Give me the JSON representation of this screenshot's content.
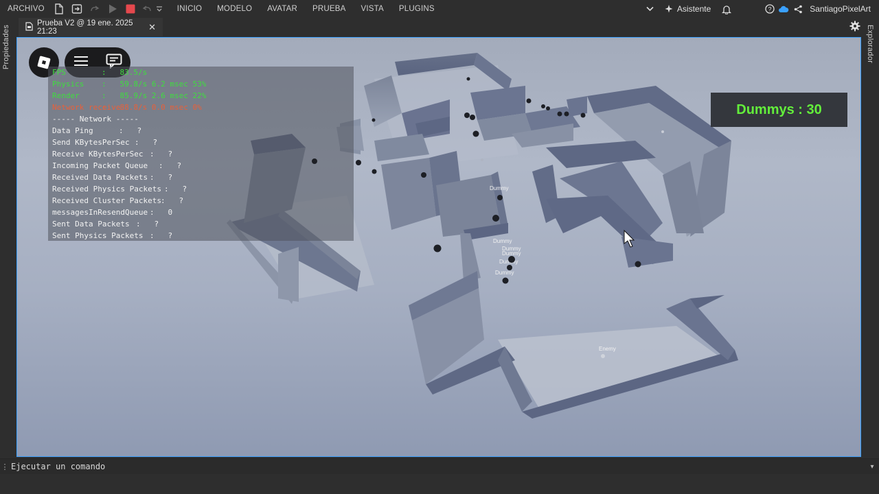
{
  "menu": {
    "file_label": "ARCHIVO",
    "items": [
      "INICIO",
      "MODELO",
      "AVATAR",
      "PRUEBA",
      "VISTA",
      "PLUGINS"
    ],
    "assistant_label": "Asistente",
    "username": "SantiagoPixelArt"
  },
  "tab": {
    "title": "Prueba V2 @ 19 ene. 2025 21:23",
    "close_glyph": "✕"
  },
  "rails": {
    "left_label": "Propiedades",
    "right_label": "Explorador"
  },
  "stats": {
    "rows": [
      {
        "label": "FPS",
        "value": ":   83.5/s",
        "color": "green"
      },
      {
        "label": "Physics",
        "value": ":   59.8/s 6.2 msec 53%",
        "color": "green"
      },
      {
        "label": "Render",
        "value": ":   85.9/s 2.6 msec 22%",
        "color": "green"
      },
      {
        "label": "Network receive",
        "value": ":   88.8/s 0.0 msec 0%",
        "color": "orange"
      },
      {
        "label": "----- Network -----",
        "value": "",
        "color": "white"
      },
      {
        "label": "Data Ping",
        "value": ":   ?",
        "color": "white"
      },
      {
        "label": "Send KBytesPerSec",
        "value": ":   ?",
        "color": "white"
      },
      {
        "label": "Receive KBytesPerSec",
        "value": ":   ?",
        "color": "white"
      },
      {
        "label": "Incoming Packet Queue",
        "value": ":   ?",
        "color": "white"
      },
      {
        "label": "Received Data Packets",
        "value": ":   ?",
        "color": "white"
      },
      {
        "label": "Received Physics Packets",
        "value": ":   ?",
        "color": "white"
      },
      {
        "label": "Received Cluster Packets",
        "value": ":   ?",
        "color": "white"
      },
      {
        "label": "messagesInResendQueue",
        "value": ":   0",
        "color": "white"
      },
      {
        "label": "Sent Data Packets",
        "value": ":   ?",
        "color": "white"
      },
      {
        "label": "Sent Physics Packets",
        "value": ":   ?",
        "color": "white"
      }
    ]
  },
  "hud": {
    "dummys_label": "Dummys : 30"
  },
  "scene": {
    "npc_labels": [
      "Dummy",
      "Dummy",
      "Dummy",
      "Dummy",
      "Dummy",
      "Dummy",
      "Enemy"
    ]
  },
  "command": {
    "placeholder": "Ejecutar un comando"
  },
  "colors": {
    "accent": "#3aa0ff",
    "stats_green": "#3fdd3f",
    "stats_orange": "#e8603a",
    "dummys_green": "#63ee3b",
    "stop_red": "#e5484d"
  }
}
